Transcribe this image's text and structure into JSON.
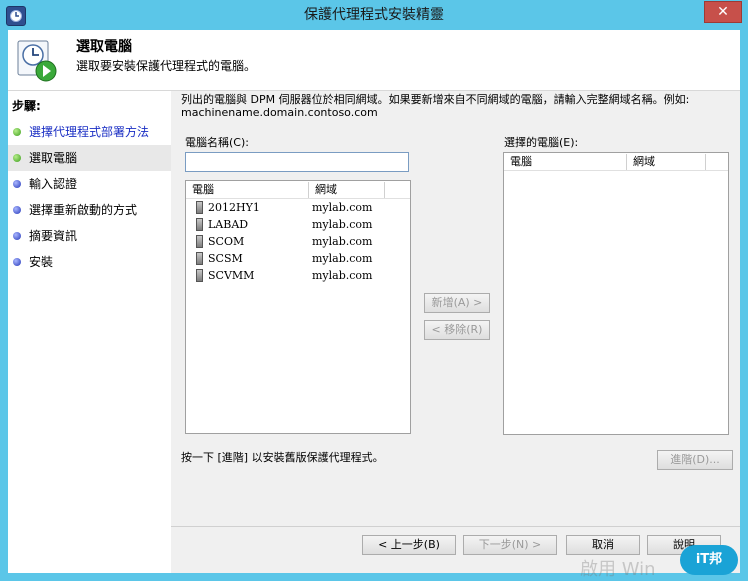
{
  "window": {
    "title": "保護代理程式安裝精靈",
    "close_icon": "✕"
  },
  "header": {
    "title": "選取電腦",
    "subtitle": "選取要安裝保護代理程式的電腦。"
  },
  "steps": {
    "title": "步驟:",
    "items": [
      {
        "label": "選擇代理程式部署方法",
        "status": "green",
        "link": true,
        "selected": false
      },
      {
        "label": "選取電腦",
        "status": "green",
        "link": false,
        "selected": true
      },
      {
        "label": "輸入認證",
        "status": "blue",
        "link": false,
        "selected": false
      },
      {
        "label": "選擇重新啟動的方式",
        "status": "blue",
        "link": false,
        "selected": false
      },
      {
        "label": "摘要資訊",
        "status": "blue",
        "link": false,
        "selected": false
      },
      {
        "label": "安裝",
        "status": "blue",
        "link": false,
        "selected": false
      }
    ]
  },
  "main": {
    "description": "列出的電腦與 DPM 伺服器位於相同網域。如果要新增來自不同網域的電腦，請輸入完整網域名稱。例如: machinename.domain.contoso.com",
    "computer_name_label": "電腦名稱(C):",
    "computer_name_value": "",
    "available": {
      "columns": [
        "電腦",
        "網域"
      ],
      "rows": [
        {
          "name": "2012HY1",
          "domain": "mylab.com"
        },
        {
          "name": "LABAD",
          "domain": "mylab.com"
        },
        {
          "name": "SCOM",
          "domain": "mylab.com"
        },
        {
          "name": "SCSM",
          "domain": "mylab.com"
        },
        {
          "name": "SCVMM",
          "domain": "mylab.com"
        }
      ]
    },
    "add_button": "新增(A) >",
    "remove_button": "< 移除(R)",
    "selected_label": "選擇的電腦(E):",
    "selected": {
      "columns": [
        "電腦",
        "網域"
      ],
      "rows": []
    },
    "advanced_text": "按一下 [進階] 以安裝舊版保護代理程式。",
    "advanced_button": "進階(D)..."
  },
  "footer": {
    "back_button": "< 上一步(B)",
    "next_button": "下一步(N) >",
    "cancel_button": "取消",
    "help_button": "說明"
  },
  "overlay": {
    "watermark": "啟用 Win",
    "badge": "iT邦"
  }
}
